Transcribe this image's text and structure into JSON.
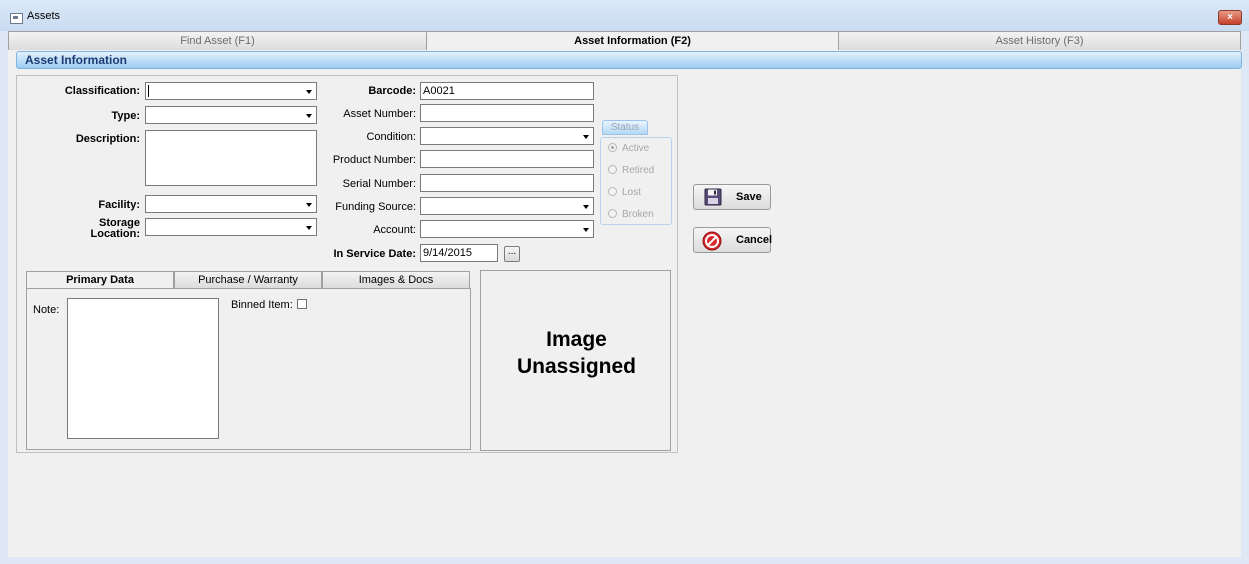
{
  "window": {
    "title": "Assets",
    "close_glyph": "×"
  },
  "tabs": [
    {
      "label": "Find Asset (F1)",
      "active": false
    },
    {
      "label": "Asset Information (F2)",
      "active": true
    },
    {
      "label": "Asset History (F3)",
      "active": false
    }
  ],
  "section_title": "Asset Information",
  "left_fields": {
    "classification_label": "Classification:",
    "type_label": "Type:",
    "description_label": "Description:",
    "facility_label": "Facility:",
    "storage_location_label_1": "Storage",
    "storage_location_label_2": "Location:"
  },
  "middle_fields": {
    "barcode_label": "Barcode:",
    "barcode_value": "A0021",
    "asset_number_label": "Asset Number:",
    "condition_label": "Condition:",
    "product_number_label": "Product Number:",
    "serial_number_label": "Serial Number:",
    "funding_source_label": "Funding Source:",
    "account_label": "Account:",
    "in_service_date_label": "In Service Date:",
    "in_service_date_value": "9/14/2015",
    "date_picker_label": "..."
  },
  "status": {
    "title": "Status",
    "options": [
      "Active",
      "Retired",
      "Lost",
      "Broken"
    ],
    "selected": "Active"
  },
  "actions": {
    "save_label": "Save",
    "cancel_label": "Cancel"
  },
  "sub_tabs": [
    {
      "label": "Primary Data",
      "active": true
    },
    {
      "label": "Purchase / Warranty",
      "active": false
    },
    {
      "label": "Images & Docs",
      "active": false
    }
  ],
  "primary_data": {
    "note_label": "Note:",
    "binned_item_label": "Binned Item:"
  },
  "image_panel": {
    "line1": "Image",
    "line2": "Unassigned"
  },
  "icons": {
    "save": "floppy-disk-icon",
    "cancel": "no-entry-icon",
    "colors": {
      "cancel_red": "#d8262b",
      "accent_blue": "#1c3b74"
    }
  }
}
